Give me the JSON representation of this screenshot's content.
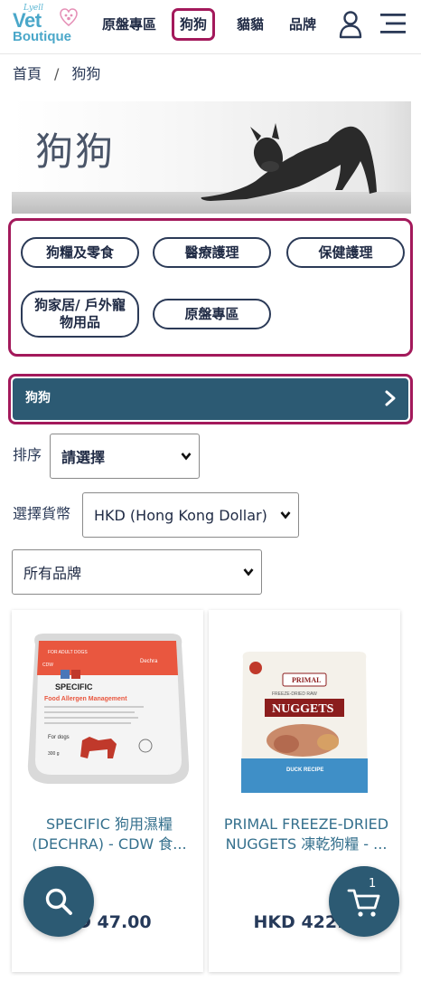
{
  "header": {
    "logo": {
      "small": "Lyell",
      "line1": "Vet",
      "line2": "Boutique"
    },
    "nav": [
      "原盤專區",
      "狗狗",
      "貓貓",
      "品牌"
    ],
    "active_nav": "狗狗"
  },
  "breadcrumb": {
    "home": "首頁",
    "separator": "/",
    "current": "狗狗"
  },
  "banner": {
    "title": "狗狗"
  },
  "categories": [
    "狗糧及零食",
    "醫療護理",
    "保健護理",
    "狗家居/ 戶外寵物用品",
    "原盤專區"
  ],
  "subcategory_bar": {
    "label": "狗狗"
  },
  "filters": {
    "sort_label": "排序",
    "sort_value": "請選擇",
    "currency_label": "選擇貨幣",
    "currency_value": "HKD (Hong Kong Dollar)",
    "brand_value": "所有品牌"
  },
  "products": [
    {
      "name": "SPECIFIC 狗用濕糧 (DECHRA) - CDW 食...",
      "price": "KD 47.00",
      "pack_text": {
        "top": "FOR ADULT DOGS",
        "brand": "SPECIFIC",
        "maker": "Dechra",
        "code": "CDW",
        "title": "Food Allergen Management",
        "for": "For dogs",
        "weight": "300 g"
      }
    },
    {
      "name": "PRIMAL FREEZE-DRIED NUGGETS 凍乾狗糧 - ...",
      "price": "HKD 422.0",
      "pack_text": {
        "banner": "FREEZE-DRIED RAW",
        "brand": "PRIMAL",
        "title": "NUGGETS",
        "recipe": "DUCK RECIPE"
      }
    }
  ],
  "cart": {
    "count": "1"
  },
  "colors": {
    "accent_border": "#a3195b",
    "primary_dark": "#2c5a73",
    "text_dark": "#1f2a44",
    "link_blue": "#35708d",
    "logo_blue": "#4aa7c9"
  },
  "icons": [
    "paw-heart-icon",
    "user-icon",
    "hamburger-menu-icon",
    "chevron-right-icon",
    "chevron-down-icon",
    "search-icon",
    "cart-icon"
  ]
}
